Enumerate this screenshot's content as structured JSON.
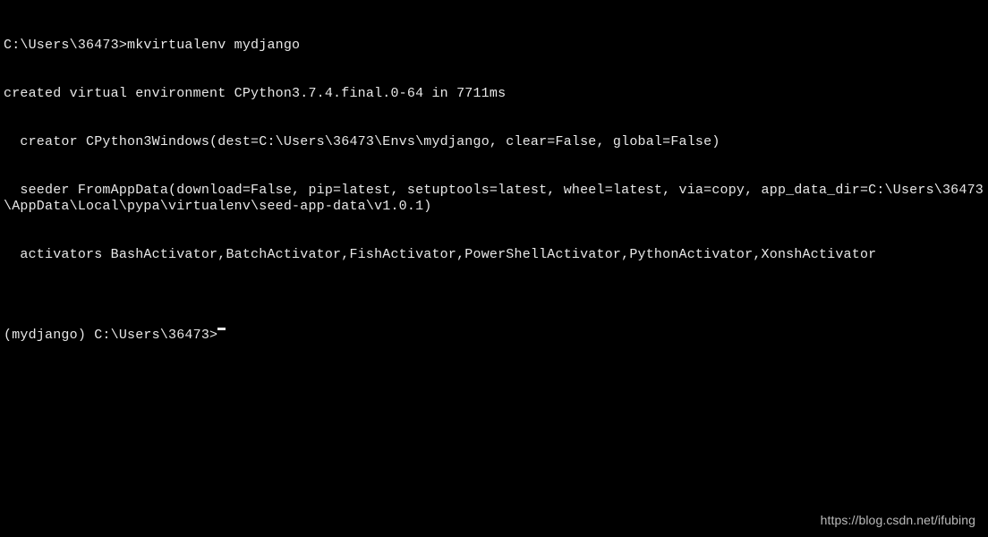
{
  "terminal": {
    "lines": [
      "C:\\Users\\36473>mkvirtualenv mydjango",
      "created virtual environment CPython3.7.4.final.0-64 in 7711ms",
      "  creator CPython3Windows(dest=C:\\Users\\36473\\Envs\\mydjango, clear=False, global=False)",
      "  seeder FromAppData(download=False, pip=latest, setuptools=latest, wheel=latest, via=copy, app_data_dir=C:\\Users\\36473\\AppData\\Local\\pypa\\virtualenv\\seed-app-data\\v1.0.1)",
      "  activators BashActivator,BatchActivator,FishActivator,PowerShellActivator,PythonActivator,XonshActivator",
      "",
      "(mydjango) C:\\Users\\36473>"
    ]
  },
  "watermark": "https://blog.csdn.net/ifubing"
}
